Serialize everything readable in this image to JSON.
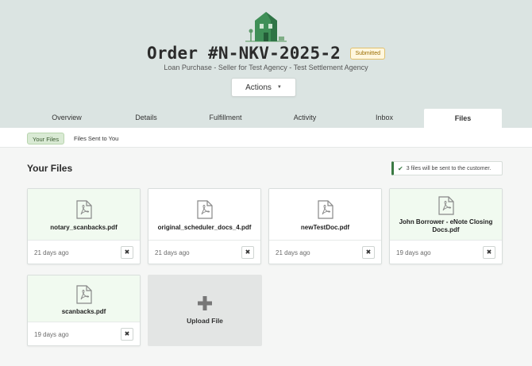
{
  "order": {
    "title": "Order #N-NKV-2025-2",
    "status": "Submitted",
    "subtitle": "Loan Purchase - Seller for Test Agency - Test Settlement Agency",
    "actions_label": "Actions"
  },
  "tabs": [
    {
      "label": "Overview"
    },
    {
      "label": "Details"
    },
    {
      "label": "Fulfillment"
    },
    {
      "label": "Activity"
    },
    {
      "label": "Inbox"
    },
    {
      "label": "Files",
      "active": true
    }
  ],
  "subtabs": [
    {
      "label": "Your Files",
      "active": true
    },
    {
      "label": "Files Sent to You"
    }
  ],
  "section": {
    "title": "Your Files",
    "notice": "3 files will be sent to the customer."
  },
  "files": [
    {
      "name": "notary_scanbacks.pdf",
      "age": "21 days ago"
    },
    {
      "name": "original_scheduler_docs_4.pdf",
      "age": "21 days ago"
    },
    {
      "name": "newTestDoc.pdf",
      "age": "21 days ago"
    },
    {
      "name": "John Borrower - eNote Closing Docs.pdf",
      "age": "19 days ago"
    },
    {
      "name": "scanbacks.pdf",
      "age": "19 days ago"
    }
  ],
  "upload": {
    "label": "Upload File"
  },
  "icons": {
    "logo": "house-icon",
    "file": "pdf-file-icon",
    "delete": "close-icon",
    "upload": "plus-icon",
    "notice": "check-icon",
    "dropdown": "caret-down-icon"
  },
  "colors": {
    "header_bg": "#dbe4e2",
    "accent_green": "#3a7a43",
    "badge_text": "#9a6d00",
    "card_top": "#f1faf0"
  }
}
